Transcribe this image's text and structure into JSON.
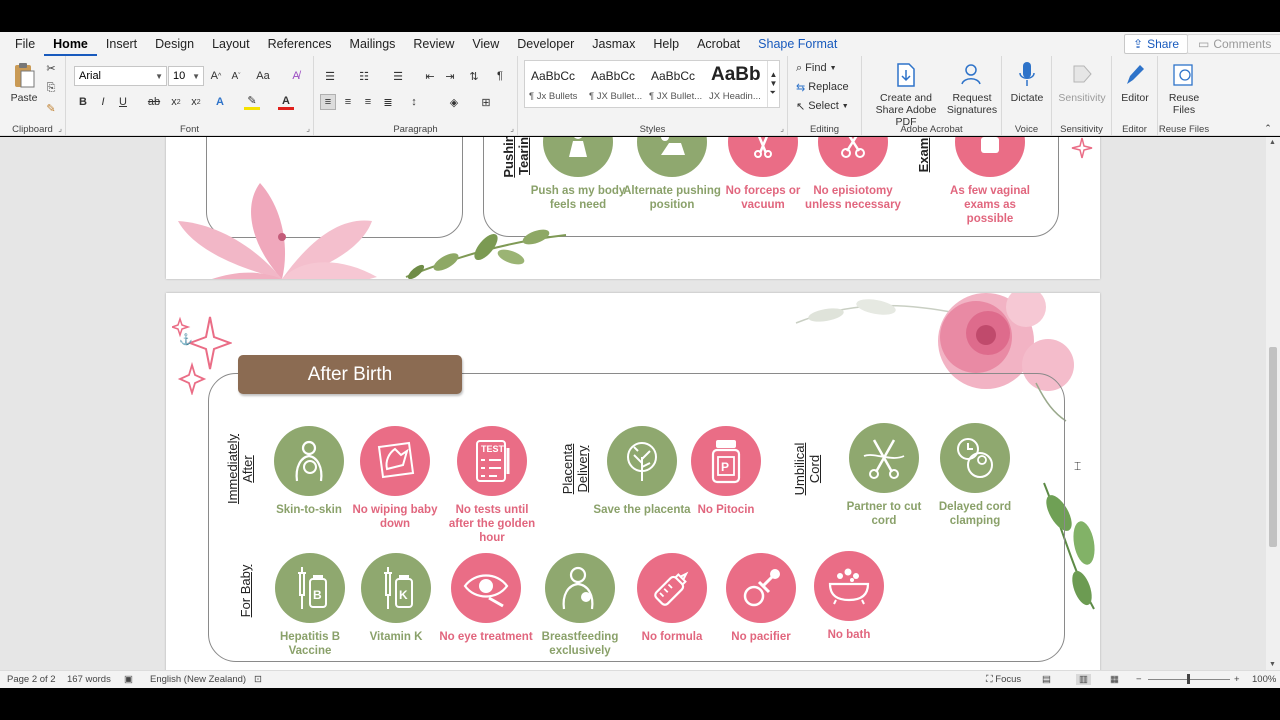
{
  "menu": {
    "tabs": [
      {
        "label": "File"
      },
      {
        "label": "Home"
      },
      {
        "label": "Insert"
      },
      {
        "label": "Design"
      },
      {
        "label": "Layout"
      },
      {
        "label": "References"
      },
      {
        "label": "Mailings"
      },
      {
        "label": "Review"
      },
      {
        "label": "View"
      },
      {
        "label": "Developer"
      },
      {
        "label": "Jasmax"
      },
      {
        "label": "Help"
      },
      {
        "label": "Acrobat"
      },
      {
        "label": "Shape Format"
      }
    ],
    "share": "Share",
    "comments": "Comments"
  },
  "ribbon": {
    "clipboard": {
      "label": "Clipboard",
      "paste": "Paste"
    },
    "font": {
      "label": "Font",
      "name": "Arial",
      "size": "10"
    },
    "paragraph": {
      "label": "Paragraph"
    },
    "styles": {
      "label": "Styles",
      "items": [
        {
          "sample": "AaBbCc",
          "name": "¶ Jx Bullets"
        },
        {
          "sample": "AaBbCc",
          "name": "¶ JX Bullet..."
        },
        {
          "sample": "AaBbCc",
          "name": "¶ JX Bullet..."
        },
        {
          "sample": "AaBb",
          "name": "JX Headin..."
        }
      ]
    },
    "editing": {
      "label": "Editing",
      "find": "Find",
      "replace": "Replace",
      "select": "Select"
    },
    "acrobat": {
      "label": "Adobe Acrobat",
      "create": "Create and Share Adobe PDF",
      "request": "Request Signatures"
    },
    "voice": {
      "label": "Voice",
      "dictate": "Dictate"
    },
    "sensitivity": {
      "label": "Sensitivity",
      "btn": "Sensitivity"
    },
    "editor": {
      "label": "Editor",
      "btn": "Editor"
    },
    "reuse": {
      "label": "Reuse Files",
      "btn": "Reuse Files"
    }
  },
  "page1": {
    "labels": {
      "pushing": "Pushing\nTearing",
      "exam": "Exam"
    },
    "items": [
      {
        "caption": "Push as my body feels need",
        "color": "green"
      },
      {
        "caption": "Alternate pushing position",
        "color": "green"
      },
      {
        "caption": "No forceps or vacuum",
        "color": "pink"
      },
      {
        "caption": "No episiotomy unless necessary",
        "color": "pink"
      },
      {
        "caption": "As few vaginal exams as possible",
        "color": "pink"
      }
    ]
  },
  "page2": {
    "title": "After Birth",
    "labels": {
      "immediately": "Immediately\nAfter",
      "placenta": "Placenta\nDelivery",
      "cord": "Umbilical\nCord",
      "baby": "For Baby"
    },
    "row1": [
      {
        "caption": "Skin-to-skin",
        "color": "green",
        "icon": "mother-baby-icon"
      },
      {
        "caption": "No wiping baby down",
        "color": "pink",
        "icon": "wipe-hand-icon"
      },
      {
        "caption": "No tests until after the golden hour",
        "color": "pink",
        "icon": "test-checklist-icon"
      },
      {
        "caption": "Save the placenta",
        "color": "green",
        "icon": "placenta-tree-icon"
      },
      {
        "caption": "No Pitocin",
        "color": "pink",
        "icon": "pill-bottle-icon"
      },
      {
        "caption": "Partner to cut cord",
        "color": "green",
        "icon": "scissors-cord-icon"
      },
      {
        "caption": "Delayed cord clamping",
        "color": "green",
        "icon": "baby-clock-icon"
      }
    ],
    "row2": [
      {
        "caption": "Hepatitis B Vaccine",
        "color": "green",
        "icon": "vaccine-b-icon",
        "letter": "B"
      },
      {
        "caption": "Vitamin K",
        "color": "green",
        "icon": "vaccine-k-icon",
        "letter": "K"
      },
      {
        "caption": "No eye treatment",
        "color": "pink",
        "icon": "eye-drop-icon"
      },
      {
        "caption": "Breastfeeding exclusively",
        "color": "green",
        "icon": "breastfeeding-icon"
      },
      {
        "caption": "No formula",
        "color": "pink",
        "icon": "baby-bottle-icon"
      },
      {
        "caption": "No pacifier",
        "color": "pink",
        "icon": "pacifier-icon"
      },
      {
        "caption": "No bath",
        "color": "pink",
        "icon": "bathtub-icon"
      }
    ]
  },
  "status": {
    "page": "Page 2 of 2",
    "words": "167 words",
    "language": "English (New Zealand)",
    "focus": "Focus",
    "zoom": "100%"
  },
  "colors": {
    "green": "#8fa86f",
    "pink": "#ea6d86",
    "title_bg": "#8b6b52",
    "accent": "#185abd"
  }
}
